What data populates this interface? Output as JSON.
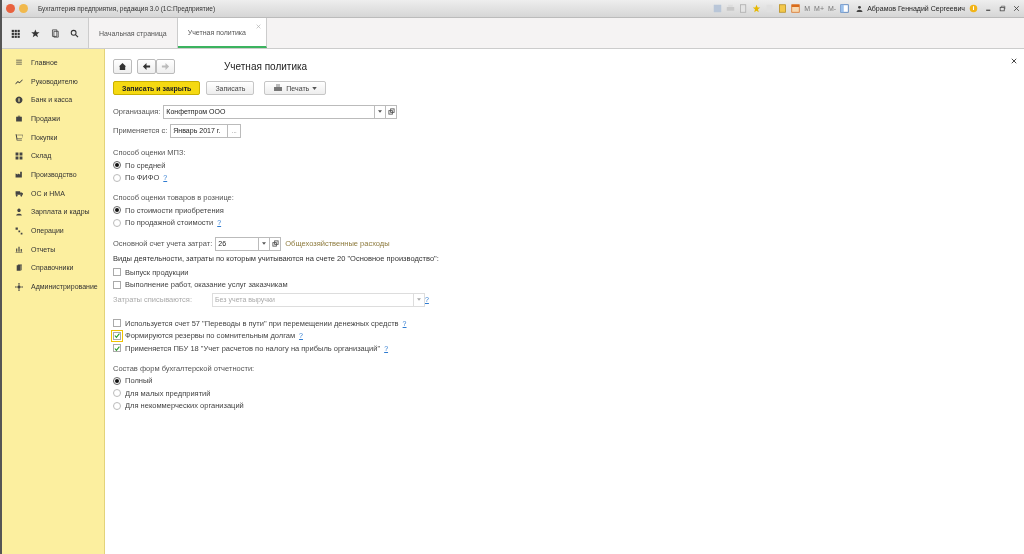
{
  "window": {
    "title": "Бухгалтерия предприятия, редакция 3.0  (1С:Предприятие)",
    "memory_buttons": [
      "M",
      "M+",
      "M-"
    ],
    "user": "Абрамов Геннадий Сергеевич"
  },
  "tabs": [
    {
      "label": "Начальная страница",
      "selected": false,
      "closable": false
    },
    {
      "label": "Учетная политика",
      "selected": true,
      "closable": true
    }
  ],
  "sidebar": {
    "items": [
      "Главное",
      "Руководителю",
      "Банк и касса",
      "Продажи",
      "Покупки",
      "Склад",
      "Производство",
      "ОС и НМА",
      "Зарплата и кадры",
      "Операции",
      "Отчеты",
      "Справочники",
      "Администрирование"
    ]
  },
  "form": {
    "title": "Учетная политика",
    "buttons": {
      "primary": "Записать и закрыть",
      "save": "Записать",
      "print": "Печать"
    },
    "organization": {
      "label": "Организация:",
      "value": "Конфетпром ООО"
    },
    "applies_from": {
      "label": "Применяется с:",
      "value": "Январь 2017 г.",
      "button": "..."
    },
    "groups": [
      {
        "title": "Способ оценки МПЗ:",
        "options": [
          {
            "label": "По средней",
            "selected": true
          },
          {
            "label": "По ФИФО",
            "selected": false,
            "help": "?"
          }
        ]
      },
      {
        "title": "Способ оценки товаров в рознице:",
        "options": [
          {
            "label": "По стоимости приобретения",
            "selected": true
          },
          {
            "label": "По продажной стоимости",
            "selected": false,
            "help": "?"
          }
        ]
      }
    ],
    "cost_account": {
      "label": "Основной счет учета затрат:",
      "value": "26",
      "link": "Общехозяйственные расходы"
    },
    "activities_title": "Виды деятельности, затраты по которым учитываются на счете 20 \"Основное производство\":",
    "activities": [
      {
        "label": "Выпуск продукции",
        "checked": false
      },
      {
        "label": "Выполнение работ, оказание услуг заказчикам",
        "checked": false
      }
    ],
    "write_off": {
      "label": "Затраты списываются:",
      "value": "Без учета выручки",
      "disabled": true,
      "help": "?"
    },
    "options": [
      {
        "label": "Используется счет 57 \"Переводы в пути\" при перемещении денежных средств",
        "checked": false,
        "focused": false,
        "help": "?"
      },
      {
        "label": "Формируются резервы по сомнительным долгам",
        "checked": true,
        "focused": true,
        "help": "?"
      },
      {
        "label": "Применяется ПБУ 18 \"Учет расчетов по налогу на прибыль организаций\"",
        "checked": true,
        "focused": false,
        "help": "?"
      }
    ],
    "reports": {
      "title": "Состав форм бухгалтерской отчетности:",
      "options": [
        {
          "label": "Полный",
          "selected": true
        },
        {
          "label": "Для малых предприятий",
          "selected": false
        },
        {
          "label": "Для некоммерческих организаций",
          "selected": false
        }
      ]
    }
  }
}
